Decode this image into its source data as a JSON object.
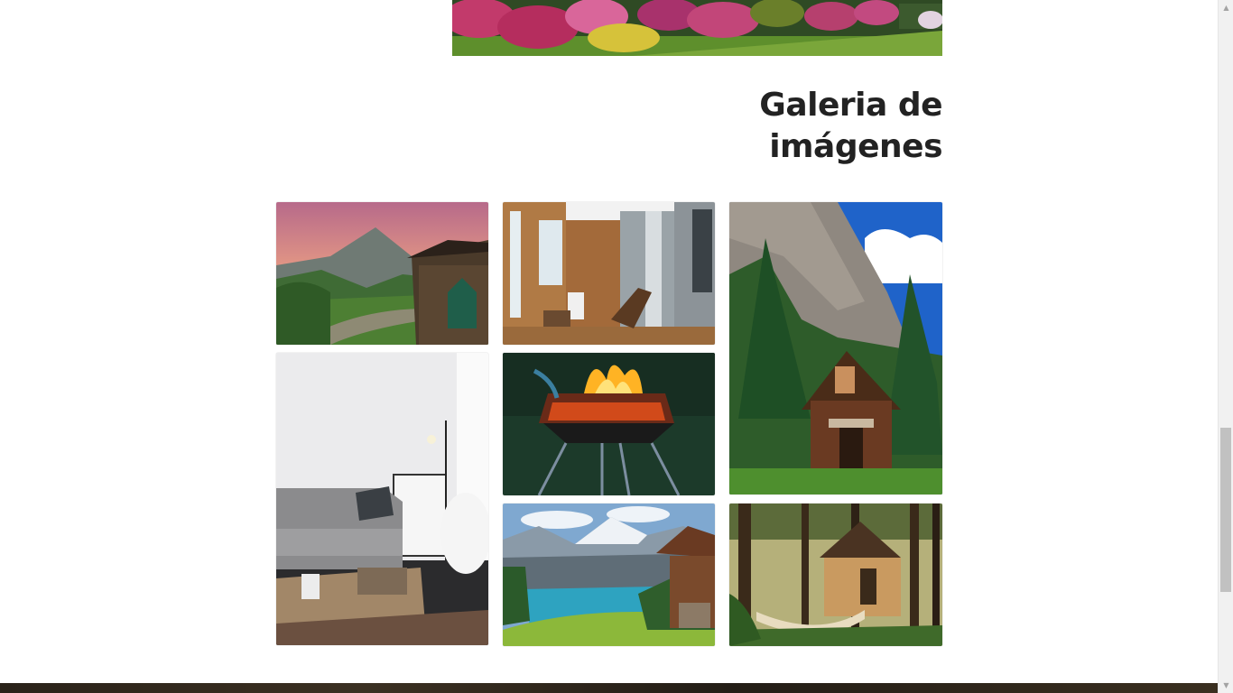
{
  "gallery": {
    "title_line1": "Galeria de",
    "title_line2": "imágenes",
    "images": [
      {
        "name": "mountain-cabin-sunset"
      },
      {
        "name": "wooden-porch-chair"
      },
      {
        "name": "log-cabin-pine-forest"
      },
      {
        "name": "living-room-sofa"
      },
      {
        "name": "campfire-brazier"
      },
      {
        "name": "alpine-lake-cabin"
      },
      {
        "name": "forest-cabin-hammock"
      }
    ]
  },
  "scrollbar": {
    "up_icon": "▲",
    "down_icon": "▼"
  }
}
